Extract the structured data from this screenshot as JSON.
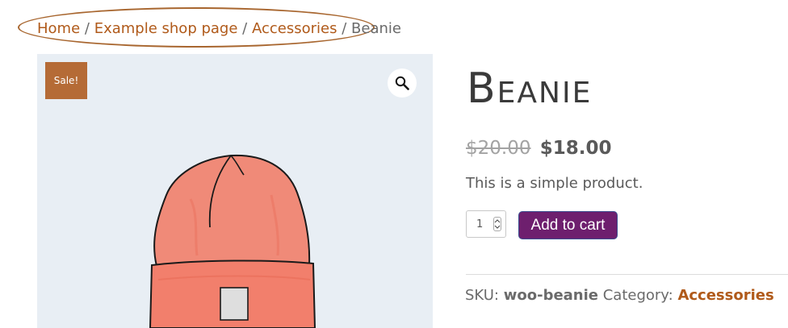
{
  "breadcrumb": {
    "items": [
      "Home",
      "Example shop page",
      "Accessories"
    ],
    "current": "Beanie",
    "separator": "/"
  },
  "image": {
    "sale_badge": "Sale!",
    "zoom_icon": "magnifier-icon"
  },
  "product": {
    "title": "Beanie",
    "price_old": "$20.00",
    "price_new": "$18.00",
    "short_description": "This is a simple product.",
    "quantity": "1",
    "add_to_cart_label": "Add to cart",
    "sku_label": "SKU:",
    "sku_value": "woo-beanie",
    "category_label": "Category:",
    "category_value": "Accessories"
  },
  "colors": {
    "link": "#b05a1a",
    "sale_badge": "#b56b36",
    "button": "#6e1f6e",
    "highlight_ellipse": "#a8662f"
  }
}
